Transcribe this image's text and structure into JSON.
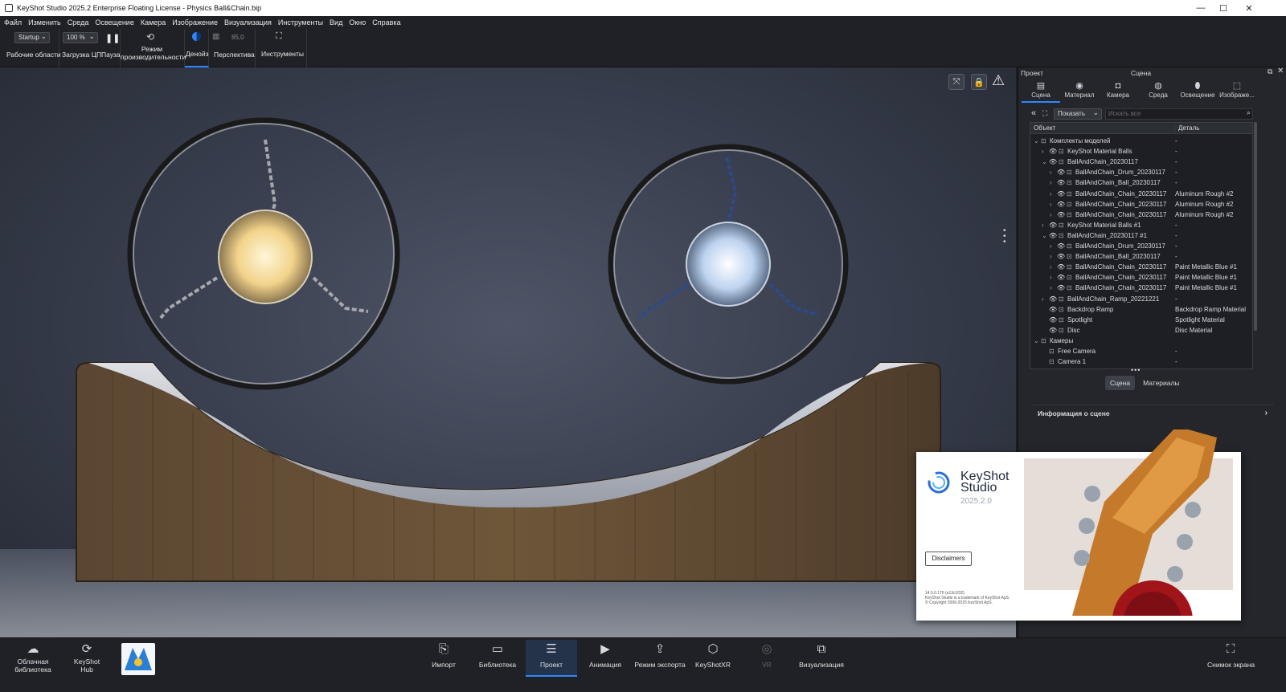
{
  "window": {
    "title": "KeyShot Studio 2025.2 Enterprise Floating License  -  Physics Ball&Chain.bip",
    "controls": [
      "—",
      "☐",
      "✕"
    ]
  },
  "menu": [
    "Файл",
    "Изменить",
    "Среда",
    "Освещение",
    "Камера",
    "Изображение",
    "Визуализация",
    "Инструменты",
    "Вид",
    "Окно",
    "Справка"
  ],
  "toolbar": {
    "workspace_value": "Startup",
    "workspace_label": "Рабочие области",
    "cpu_value": "100 %",
    "cpu_label": "Загрузка ЦП",
    "pause_label": "Пауза",
    "perf_label_1": "Режим",
    "perf_label_2": "производительности",
    "denoise_label": "Денойз",
    "fov_value": "85,0",
    "perspective_label": "Перспектива",
    "tools_label": "Инструменты"
  },
  "panel": {
    "left_title": "Проект",
    "center_title": "Сцена",
    "tabs": [
      {
        "label": "Сцена",
        "icon": "scene-icon",
        "glyph": "▤",
        "active": true
      },
      {
        "label": "Материал",
        "icon": "material-icon",
        "glyph": "◉"
      },
      {
        "label": "Камера",
        "icon": "camera-icon",
        "glyph": "◘"
      },
      {
        "label": "Среда",
        "icon": "environment-icon",
        "glyph": "◍"
      },
      {
        "label": "Освещение",
        "icon": "lighting-icon",
        "glyph": "⬮"
      },
      {
        "label": "Изображе...",
        "icon": "image-icon",
        "glyph": "⬚"
      }
    ],
    "filter_value": "Показать",
    "search_placeholder": "Искать все",
    "col_object": "Объект",
    "col_detail": "Деталь",
    "tree": [
      {
        "indent": 0,
        "arrow": "⌄",
        "name": "Комплекты моделей",
        "detail": "-",
        "eye": false
      },
      {
        "indent": 1,
        "arrow": "›",
        "name": "KeyShot Material Balls",
        "detail": "-",
        "eye": true
      },
      {
        "indent": 1,
        "arrow": "⌄",
        "name": "BallAndChain_20230117",
        "detail": "-",
        "eye": true
      },
      {
        "indent": 2,
        "arrow": "›",
        "name": "BallAndChain_Drum_20230117",
        "detail": "-",
        "eye": true
      },
      {
        "indent": 2,
        "arrow": "›",
        "name": "BallAndChain_Ball_20230117",
        "detail": "-",
        "eye": true
      },
      {
        "indent": 2,
        "arrow": "›",
        "name": "BallAndChain_Chain_20230117",
        "detail": "Aluminum Rough #2",
        "eye": true
      },
      {
        "indent": 2,
        "arrow": "›",
        "name": "BallAndChain_Chain_20230117",
        "detail": "Aluminum Rough #2",
        "eye": true
      },
      {
        "indent": 2,
        "arrow": "›",
        "name": "BallAndChain_Chain_20230117",
        "detail": "Aluminum Rough #2",
        "eye": true
      },
      {
        "indent": 1,
        "arrow": "›",
        "name": "KeyShot Material Balls #1",
        "detail": "-",
        "eye": true
      },
      {
        "indent": 1,
        "arrow": "⌄",
        "name": "BallAndChain_20230117 #1",
        "detail": "-",
        "eye": true
      },
      {
        "indent": 2,
        "arrow": "›",
        "name": "BallAndChain_Drum_20230117",
        "detail": "-",
        "eye": true
      },
      {
        "indent": 2,
        "arrow": "›",
        "name": "BallAndChain_Ball_20230117",
        "detail": "-",
        "eye": true
      },
      {
        "indent": 2,
        "arrow": "›",
        "name": "BallAndChain_Chain_20230117",
        "detail": "Paint Metallic Blue #1",
        "eye": true
      },
      {
        "indent": 2,
        "arrow": "›",
        "name": "BallAndChain_Chain_20230117",
        "detail": "Paint Metallic Blue #1",
        "eye": true
      },
      {
        "indent": 2,
        "arrow": "›",
        "name": "BallAndChain_Chain_20230117",
        "detail": "Paint Metallic Blue #1",
        "eye": true
      },
      {
        "indent": 1,
        "arrow": "›",
        "name": "BallAndChain_Ramp_20221221",
        "detail": "-",
        "eye": true
      },
      {
        "indent": 1,
        "arrow": "",
        "name": "Backdrop Ramp",
        "detail": "Backdrop Ramp Material",
        "eye": true
      },
      {
        "indent": 1,
        "arrow": "",
        "name": "Spotlight",
        "detail": "Spotlight Material",
        "eye": true
      },
      {
        "indent": 1,
        "arrow": "",
        "name": "Disc",
        "detail": "Disc Material",
        "eye": true
      },
      {
        "indent": 0,
        "arrow": "⌄",
        "name": "Камеры",
        "detail": "",
        "eye": false
      },
      {
        "indent": 1,
        "arrow": "",
        "name": "Free Camera",
        "detail": "-",
        "eye": false
      },
      {
        "indent": 1,
        "arrow": "",
        "name": "Camera 1",
        "detail": "-",
        "eye": false
      }
    ],
    "subtab_scene": "Сцена",
    "subtab_materials": "Материалы",
    "scene_info": "Информация о сцене"
  },
  "bottom": {
    "cloud": [
      "Облачная",
      "библиотека"
    ],
    "hub": [
      "KeyShot",
      "Hub"
    ],
    "items": [
      {
        "label": "Импорт",
        "icon": "import-icon",
        "glyph": "⎘"
      },
      {
        "label": "Библиотека",
        "icon": "library-icon",
        "glyph": "▭"
      },
      {
        "label": "Проект",
        "icon": "project-icon",
        "glyph": "☰",
        "active": true
      },
      {
        "label": "Анимация",
        "icon": "animation-icon",
        "glyph": "▶"
      },
      {
        "label": "Режим экспорта",
        "icon": "export-icon",
        "glyph": "⇪"
      },
      {
        "label": "KeyShotXR",
        "icon": "keyshotxr-icon",
        "glyph": "⬡"
      },
      {
        "label": "VR",
        "icon": "vr-icon",
        "glyph": "◎"
      },
      {
        "label": "Визуализация",
        "icon": "render-icon",
        "glyph": "⧉"
      }
    ],
    "screenshot": "Снимок экрана"
  },
  "splash": {
    "brand_1": "KeyShot",
    "brand_2": "Studio",
    "version": "2025.2.0",
    "disclaimers": "Disclaimers",
    "build": "14.0.0.176 (a13c1f32)",
    "trademark": "KeyShot Studio is a trademark of KeyShot ApS.",
    "copyright": "© Copyright 2006-2025 KeyShot ApS."
  },
  "colors": {
    "accent": "#2f86ff",
    "panel": "#24262b",
    "toolbar": "#1f2126"
  }
}
